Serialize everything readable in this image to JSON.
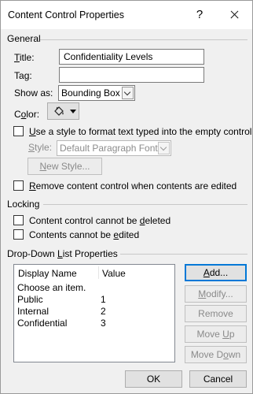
{
  "window": {
    "title": "Content Control Properties",
    "help_glyph": "?",
    "close_icon": "close-icon"
  },
  "general": {
    "section_label": "General",
    "title_label_accel": "T",
    "title_label_rest": "itle:",
    "title_value": "Confidentiality Levels",
    "tag_label_pre": "Ta",
    "tag_label_accel": "g",
    "tag_label_post": ":",
    "tag_value": "",
    "show_as_label_pre": "Show as:",
    "show_as_value": "Bounding Box",
    "color_label_pre": "C",
    "color_label_accel": "o",
    "color_label_post": "lor:",
    "use_style_label_pre": "",
    "use_style_label_accel": "U",
    "use_style_label_post": "se a style to format text typed into the empty control",
    "use_style_checked": false,
    "style_label_pre": "",
    "style_label_accel": "S",
    "style_label_post": "tyle:",
    "style_value": "Default Paragraph Font",
    "new_style_pre": "",
    "new_style_accel": "N",
    "new_style_post": "ew Style...",
    "remove_label_pre": "",
    "remove_label_accel": "R",
    "remove_label_post": "emove content control when contents are edited",
    "remove_checked": false
  },
  "locking": {
    "section_label": "Locking",
    "cannot_delete_pre": "Content control cannot be ",
    "cannot_delete_accel": "d",
    "cannot_delete_post": "eleted",
    "cannot_delete_checked": false,
    "cannot_edit_pre": "Contents cannot be ",
    "cannot_edit_accel": "e",
    "cannot_edit_post": "dited",
    "cannot_edit_checked": false
  },
  "dropdown": {
    "section_label_pre": "Drop-Down ",
    "section_label_accel": "L",
    "section_label_post": "ist Properties",
    "columns": [
      "Display Name",
      "Value"
    ],
    "rows": [
      {
        "display": "Choose an item.",
        "value": ""
      },
      {
        "display": "Public",
        "value": "1"
      },
      {
        "display": "Internal",
        "value": "2"
      },
      {
        "display": "Confidential",
        "value": "3"
      }
    ],
    "buttons": {
      "add_accel": "A",
      "add_rest": "dd...",
      "modify_accel": "M",
      "modify_rest": "odify...",
      "remove": "Remove",
      "move_up_pre": "Move ",
      "move_up_accel": "U",
      "move_up_post": "p",
      "move_down_pre": "Move D",
      "move_down_accel": "o",
      "move_down_post": "wn"
    }
  },
  "footer": {
    "ok": "OK",
    "cancel": "Cancel"
  },
  "colors": {
    "default_button_border": "#0078d7",
    "dialog_bg": "#f0f0f0"
  }
}
